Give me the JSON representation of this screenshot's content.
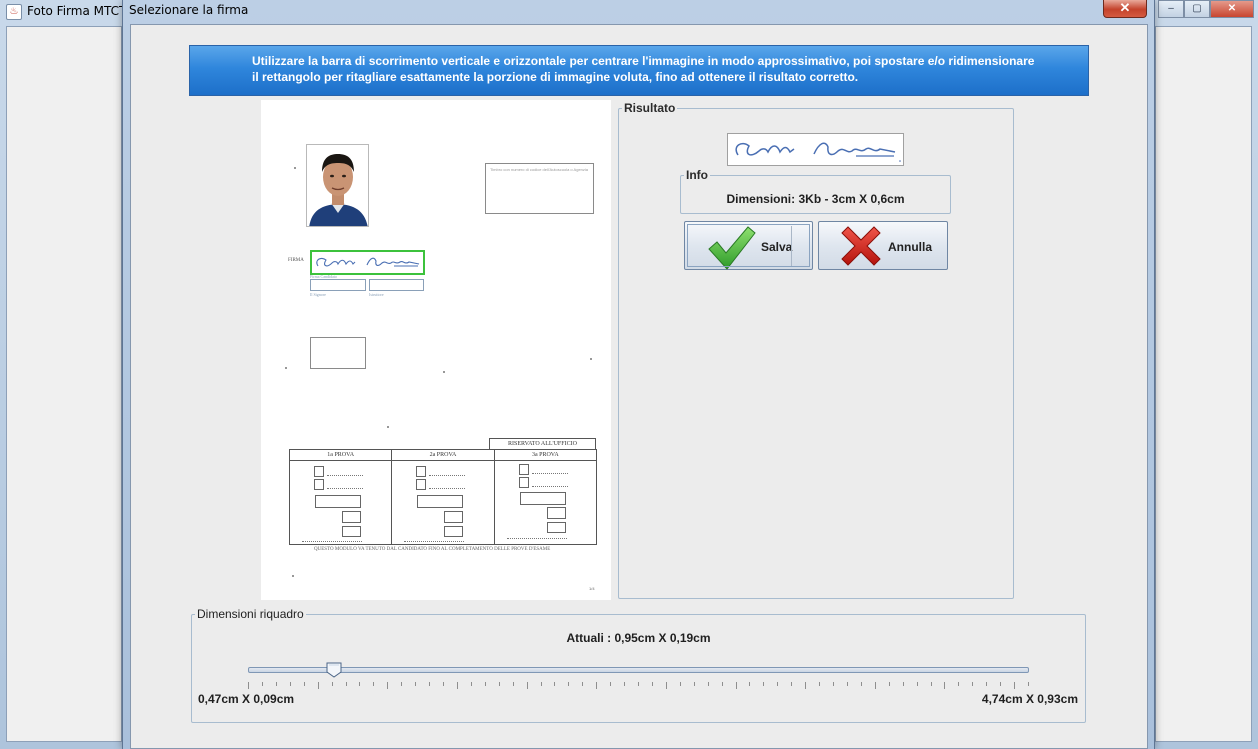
{
  "parent_window": {
    "title": "Foto Firma MTCT",
    "controls": [
      "–",
      "▢",
      "✕"
    ]
  },
  "dialog": {
    "title": "Selezionare la firma",
    "close_label": "✕"
  },
  "instructions": [
    "Utilizzare la barra di scorrimento verticale e orizzontale per centrare l'immagine in modo approssimativo, poi spostare e/o ridimensionare",
    "il rettangolo per ritagliare esattamente la porzione di immagine voluta, fino ad ottenere il risultato corretto."
  ],
  "document": {
    "firma_label": "FIRMA",
    "stamp_text": "Timbro con numero di codice dell'Autoscuola o Agenzia",
    "field_labels": [
      "Firma Candidato",
      "Il Signore",
      "Istruttore"
    ],
    "reserved_label": "RISERVATO ALL'UFFICIO",
    "exam_columns": [
      "1a PROVA",
      "2a PROVA",
      "3a PROVA"
    ],
    "footer": "QUESTO MODULO VA TENUTO DAL CANDIDATO FINO AL COMPLETAMENTO DELLE PROVE D'ESAME",
    "page_number": "1/4",
    "selection_color": "#3cc23c"
  },
  "result": {
    "legend": "Risultato",
    "info_legend": "Info",
    "dimensions_text": "Dimensioni: 3Kb - 3cm X 0,6cm",
    "save_label": "Salva",
    "cancel_label": "Annulla",
    "save_icon": "checkmark-icon",
    "cancel_icon": "red-x-icon"
  },
  "box_size": {
    "legend": "Dimensioni riquadro",
    "current_text": "Attuali : 0,95cm X 0,19cm",
    "min_label": "0,47cm X 0,09cm",
    "max_label": "4,74cm X 0,93cm",
    "slider_fraction": 0.11,
    "tick_count": 57
  },
  "colors": {
    "banner": "#2f86dc",
    "dialog_bg": "#ececec",
    "group_border": "#a8bccf"
  }
}
